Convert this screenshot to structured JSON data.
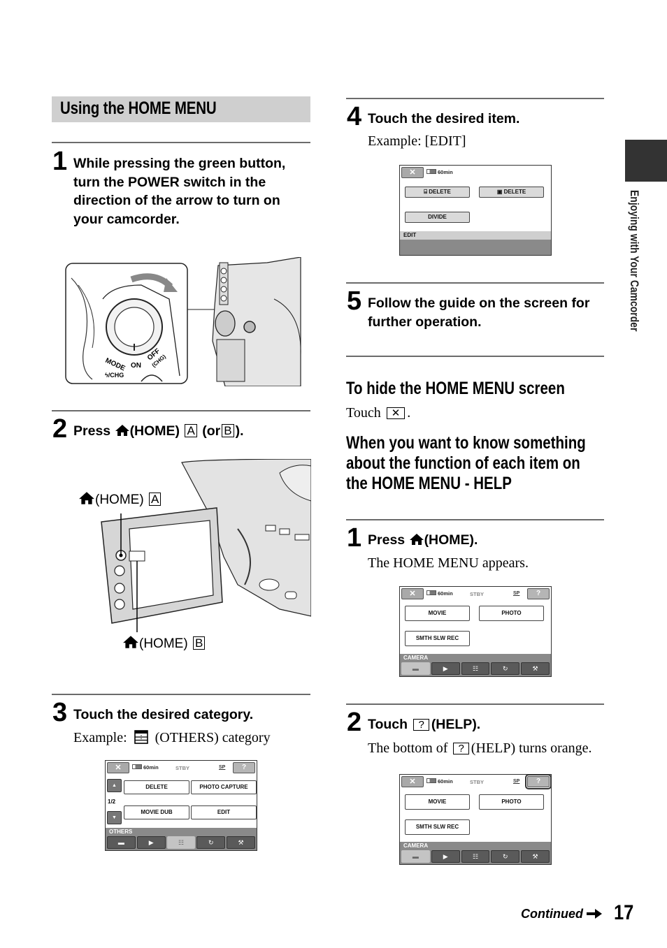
{
  "page": {
    "section_title": "Using the HOME MENU",
    "side_tab_label": "Enjoying with Your Camcorder",
    "footer": {
      "continued": "Continued",
      "page_number": "17"
    }
  },
  "left": {
    "step1": {
      "num": "1",
      "text": "While pressing the green button, turn the POWER switch in the direction of the arrow to turn on your camcorder."
    },
    "power_dial_labels": {
      "mode": "MODE",
      "on": "ON",
      "off": "OFF",
      "chg": "(CHG)",
      "flash": "ϟ/CHG"
    },
    "step2": {
      "num": "2",
      "press": "Press",
      "home": "(HOME)",
      "a": "A",
      "or": "(or",
      "b": "B",
      "end": ")."
    },
    "figure2": {
      "label_a": "(HOME)",
      "box_a": "A",
      "label_b": "(HOME)",
      "box_b": "B"
    },
    "step3": {
      "num": "3",
      "text": "Touch the desired category.",
      "example_prefix": "Example:",
      "example_suffix": "(OTHERS) category"
    },
    "screen_others": {
      "battery": "60min",
      "status": "STBY",
      "quality": "SP",
      "help": "?",
      "close": "✕",
      "page": "1/2",
      "items": [
        "DELETE",
        "PHOTO CAPTURE",
        "MOVIE DUB",
        "EDIT"
      ],
      "category": "OTHERS",
      "tabs": [
        "camera",
        "playback",
        "others",
        "manage",
        "settings"
      ],
      "active_tab": 2
    }
  },
  "right": {
    "step4": {
      "num": "4",
      "text": "Touch the desired item.",
      "example": "Example: [EDIT]"
    },
    "screen_edit": {
      "battery": "60min",
      "close": "✕",
      "items": [
        "⌸ DELETE",
        "▣ DELETE",
        "DIVIDE"
      ],
      "category": "EDIT"
    },
    "step5": {
      "num": "5",
      "text": "Follow the guide on the screen for further operation."
    },
    "hide": {
      "title": "To hide the HOME MENU screen",
      "touch": "Touch",
      "symbol": "✕",
      "end": "."
    },
    "help_heading": "When you want to know something about the function of each item on the HOME MENU - HELP",
    "help_step1": {
      "num": "1",
      "press": "Press",
      "home": "(HOME).",
      "desc": "The HOME MENU appears."
    },
    "screen_camera_1": {
      "battery": "60min",
      "status": "STBY",
      "quality": "SP",
      "help": "?",
      "close": "✕",
      "items": [
        "MOVIE",
        "PHOTO",
        "SMTH SLW REC"
      ],
      "category": "CAMERA",
      "active_tab": 0
    },
    "help_step2": {
      "num": "2",
      "touch": "Touch",
      "symbol": "?",
      "help": "(HELP).",
      "desc_prefix": "The bottom of",
      "desc_suffix": "(HELP) turns orange."
    },
    "screen_camera_2": {
      "battery": "60min",
      "status": "STBY",
      "quality": "SP",
      "help": "?",
      "close": "✕",
      "items": [
        "MOVIE",
        "PHOTO",
        "SMTH SLW REC"
      ],
      "category": "CAMERA",
      "active_tab": 0,
      "help_highlighted": true
    }
  },
  "icons": {
    "tab_glyphs": [
      "▬",
      "▶",
      "☷",
      "↻",
      "⚒"
    ]
  }
}
